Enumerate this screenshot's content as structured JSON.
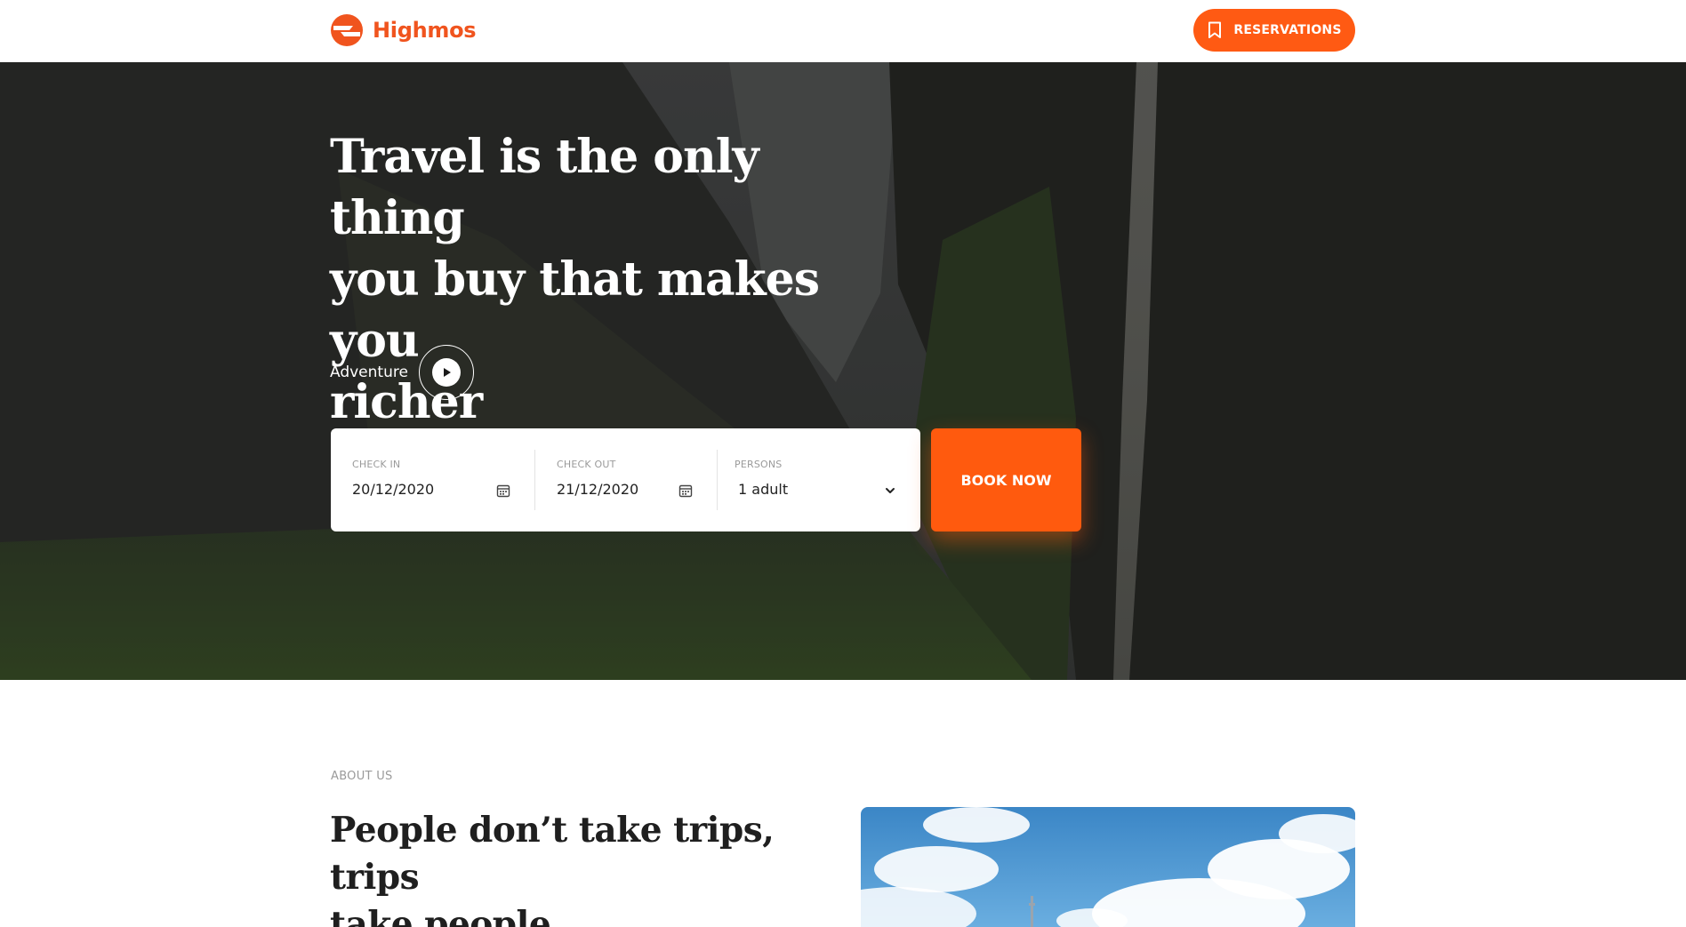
{
  "header": {
    "brand": "Highmos",
    "reservations_label": "RESERVATIONS"
  },
  "hero": {
    "title_lines": [
      "Travel is the only thing",
      "you buy that makes you",
      "richer"
    ],
    "adventure_label": "Adventure"
  },
  "booking": {
    "check_in": {
      "label": "CHECK IN",
      "value": "20/12/2020"
    },
    "check_out": {
      "label": "CHECK OUT",
      "value": "21/12/2020"
    },
    "persons": {
      "label": "PERSONS",
      "value": "1 adult"
    },
    "submit_label": "BOOK NOW"
  },
  "about": {
    "eyebrow": "ABOUT US",
    "title_lines": [
      "People don’t take trips, trips",
      "take people"
    ]
  },
  "colors": {
    "brand": "#f0541e",
    "accent": "#ff5a0e",
    "hero_overlay": "#1c1c1a"
  },
  "icons": [
    "logo-icon",
    "bookmark-icon",
    "play-icon",
    "calendar-icon",
    "chevron-down-icon"
  ]
}
